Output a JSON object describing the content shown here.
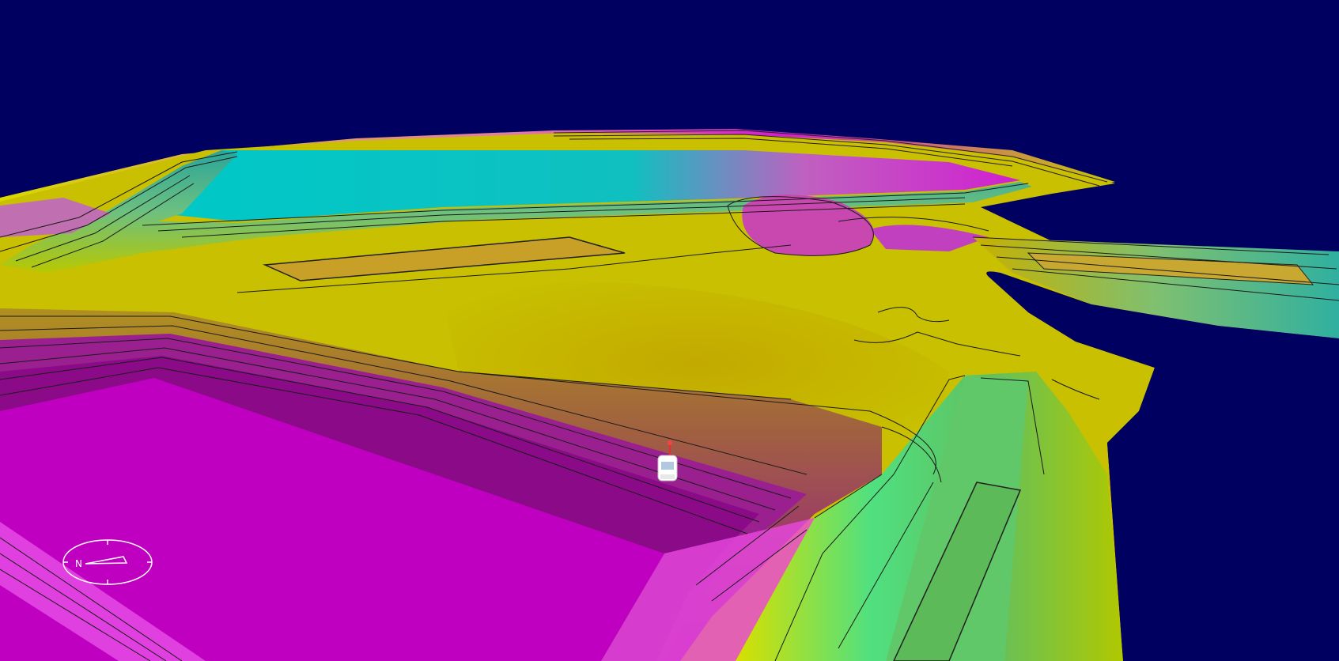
{
  "scene": {
    "sky_color": "#000060",
    "palette": {
      "magenta": "#c000c0",
      "magenta_dark": "#8a008a",
      "cyan": "#00c8c8",
      "teal": "#2aa59a",
      "yellow": "#d8d800",
      "olive": "#b8b800",
      "olive_dark": "#a8a000",
      "orange": "#c8a028",
      "green": "#5cc25c",
      "green_light": "#7fd870"
    }
  },
  "compass": {
    "north_label": "N",
    "icon": "compass-icon"
  },
  "vehicle": {
    "icon": "vehicle-icon",
    "color": "#ffffff"
  }
}
